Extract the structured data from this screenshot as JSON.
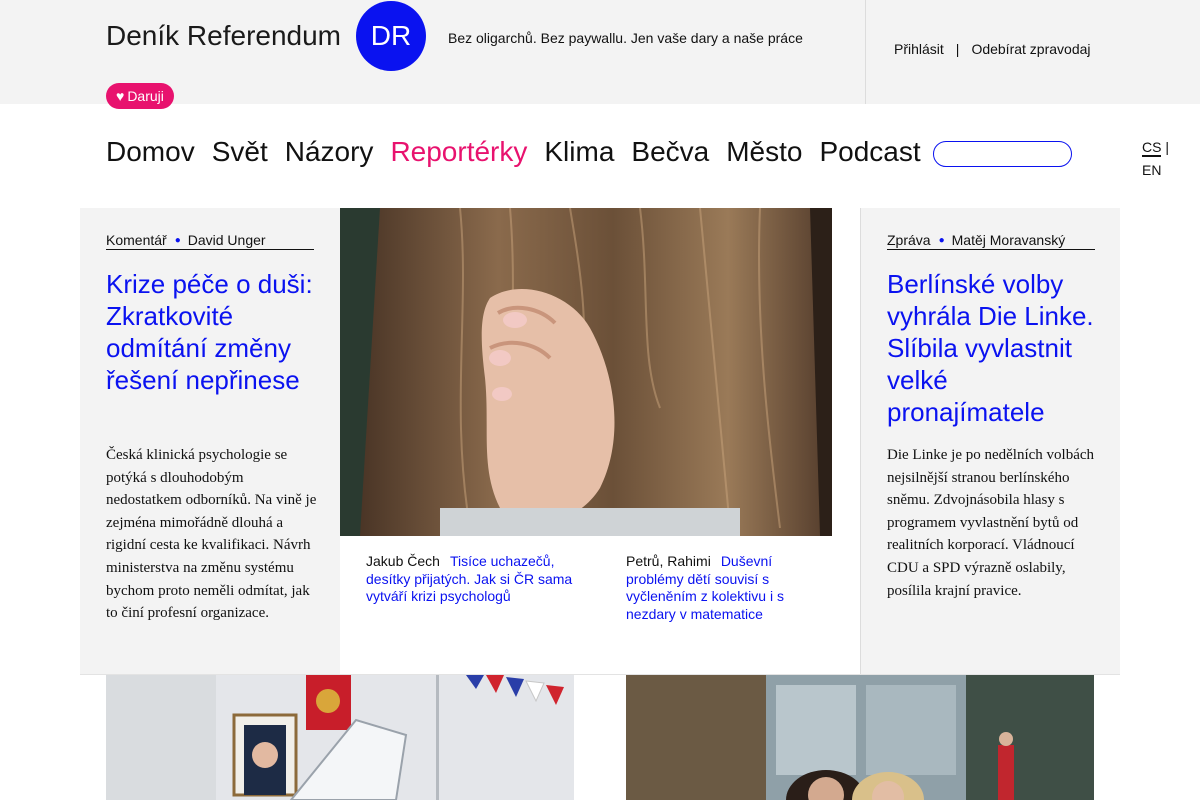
{
  "header": {
    "brand": "Deník Referendum",
    "logo_text": "DR",
    "tagline": "Bez oligarchů. Bez paywallu. Jen vaše dary a naše práce",
    "login_label": "Přihlásit",
    "separator": "|",
    "newsletter_label": "Odebírat zpravodaj",
    "donate_icon": "♥",
    "donate_label": "Daruji"
  },
  "nav": {
    "items": [
      "Domov",
      "Svět",
      "Názory",
      "Reportérky",
      "Klima",
      "Bečva",
      "Město",
      "Podcast"
    ],
    "active": "Reportérky",
    "search_placeholder": ""
  },
  "lang": {
    "cs": "CS",
    "sep": "|",
    "en": "EN"
  },
  "colors": {
    "accent_blue": "#0a12f0",
    "accent_pink": "#e8126e",
    "panel_grey": "#f3f3f3"
  },
  "articles": {
    "left": {
      "category": "Komentář",
      "author": "David Unger",
      "title": "Krize péče o duši: Zkratkovité odmítání změny řešení nepřinese",
      "perex": "Česká klinická psychologie se potýká s dlouhodobým nedostatkem odborníků. Na vině je zejména mimořádně dlouhá a rigidní cesta ke kvalifikaci. Návrh ministerstva na změnu systému bychom proto neměli odmítat, jak to činí profesní organizace."
    },
    "right": {
      "category": "Zpráva",
      "author": "Matěj Moravanský",
      "title": "Berlínské volby vyhrála Die Linke. Slíbila vyvlastnit velké pronajímatele",
      "perex": "Die Linke je po nedělních volbách nejsilnější stranou berlínského sněmu. Zdvojnásobila hlasy s programem vyvlastnění bytů od realitních korporací. Vládnoucí CDU a SPD výrazně oslabily, posílila krajní pravice."
    },
    "related": [
      {
        "author": "Jakub Čech",
        "title": "Tisíce uchazečů, desítky přijatých. Jak si ČR sama vytváří krizi psychologů"
      },
      {
        "author": "Petrů, Rahimi",
        "title": "Duševní problémy dětí souvisí s vyčleněním z kolektivu i s nezdary v matematice"
      }
    ]
  },
  "images": {
    "main": "child-covering-ear-photo",
    "bottom_left": "polling-station-putin-portrait-photo",
    "bottom_right": "women-outside-building-photo"
  }
}
